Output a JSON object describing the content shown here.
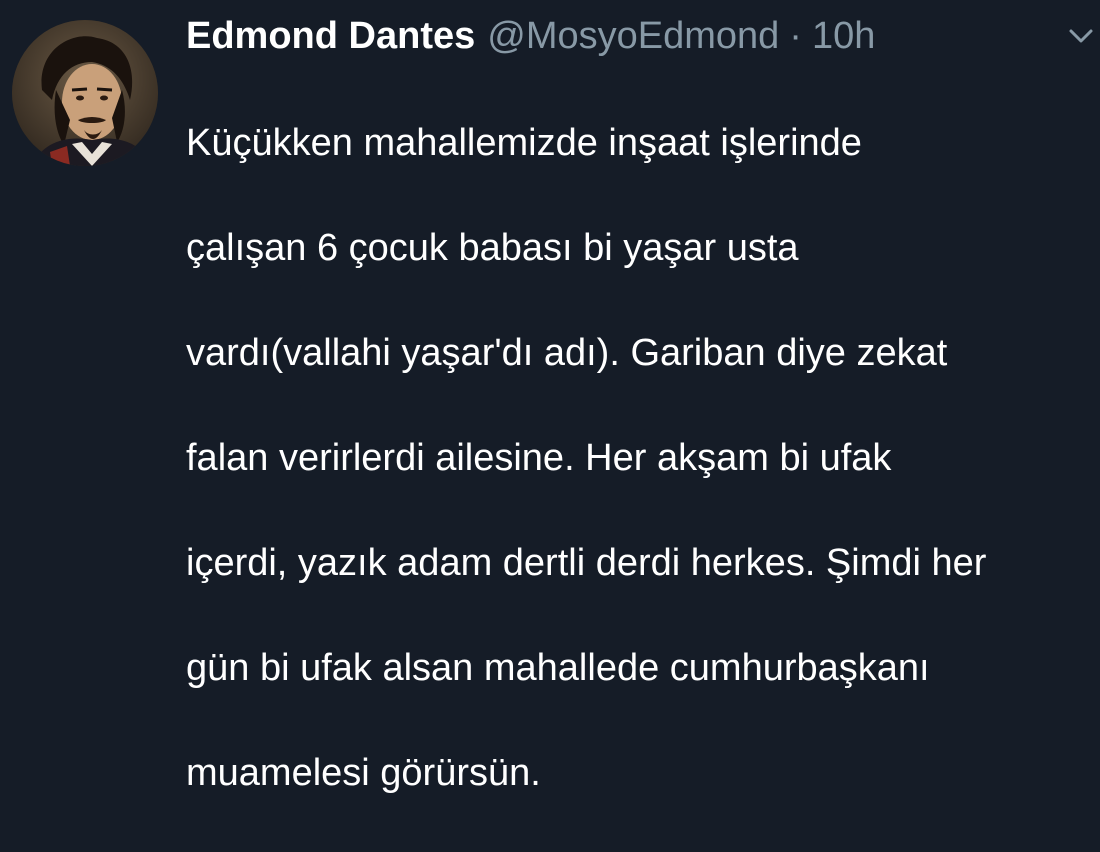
{
  "tweet": {
    "author_name": "Edmond Dantes",
    "author_handle": "@MosyoEdmond",
    "separator": "·",
    "timestamp": "10h",
    "text_lines": [
      "Küçükken mahallemizde inşaat işlerinde",
      "çalışan 6 çocuk babası bi yaşar usta",
      "vardı(vallahi yaşar'dı adı). Gariban diye zekat",
      "falan verirlerdi ailesine. Her akşam bi ufak",
      "içerdi, yazık adam dertli derdi herkes. Şimdi her",
      "gün bi ufak alsan mahallede cumhurbaşkanı",
      "muamelesi görürsün."
    ]
  },
  "icons": {
    "avatar": "user-avatar-portrait",
    "menu": "chevron-down-icon"
  },
  "colors": {
    "background": "#151c27",
    "primary_text": "#ffffff",
    "secondary_text": "#8899a6"
  }
}
